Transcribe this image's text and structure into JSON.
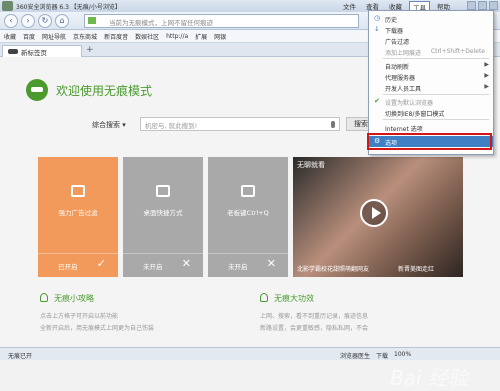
{
  "window": {
    "title": "360安全浏览器 6.3 【无痕/小号浏览】",
    "menus": [
      "文件",
      "查看",
      "收藏",
      "工具",
      "帮助"
    ],
    "active_menu": "工具"
  },
  "nav": {
    "address_placeholder": "当前为无痕模式，上网不留任何痕迹"
  },
  "bookmarks": [
    "收藏",
    "百度",
    "网址导航",
    "京东商城",
    "新百度音",
    "数娱社区",
    "http://a",
    "扩展",
    "网银"
  ],
  "tabs": [
    {
      "label": "新标签页"
    }
  ],
  "main": {
    "welcome": "欢迎使用无痕模式",
    "search_type": "综合搜索",
    "search_placeholder": "机密与, 就此搜到!",
    "search_button": "搜索"
  },
  "tiles": [
    {
      "label": "强力广告过滤",
      "state": "已开启",
      "mark": "✓",
      "color": "#f29a5b"
    },
    {
      "label": "桌面快捷方式",
      "state": "未开启",
      "mark": "✕",
      "color": "#a9a9a9"
    },
    {
      "label": "老板键Ctrl+Q",
      "state": "未开启",
      "mark": "✕",
      "color": "#a9a9a9"
    }
  ],
  "photo": {
    "title": "无聊就看",
    "caption_left": "北影学霸校花甜照萌翻网友",
    "caption_right": "新晋美图走红"
  },
  "tips": [
    {
      "heading": "无痕小攻略",
      "lines": [
        "点击上方格子可开启以前功能",
        "全新开启后，用无痕模式上网更为自己伤装"
      ]
    },
    {
      "heading": "无痕大功效",
      "lines": [
        "上网、搜索，看不到重历记录，痕迹信息",
        "新路设置，会更重敏感，隐私私网，不会"
      ]
    }
  ],
  "menu": {
    "items": [
      {
        "label": "历史",
        "shortcut": "",
        "gray": false,
        "arrow": false,
        "check": false
      },
      {
        "label": "下载器",
        "shortcut": "",
        "gray": false,
        "arrow": false,
        "check": false
      },
      {
        "label": "广告过滤",
        "shortcut": "",
        "gray": false,
        "arrow": false,
        "check": false
      },
      {
        "label": "添加上网痕迹",
        "shortcut": "Ctrl+Shift+Delete",
        "gray": true,
        "arrow": false,
        "check": false
      },
      {
        "label": "自动刷新",
        "shortcut": "",
        "gray": false,
        "arrow": true,
        "check": false
      },
      {
        "label": "代理服务器",
        "shortcut": "",
        "gray": false,
        "arrow": true,
        "check": false
      },
      {
        "label": "开发人员工具",
        "shortcut": "",
        "gray": false,
        "arrow": true,
        "check": false
      },
      {
        "label": "设置为默认浏览器",
        "shortcut": "",
        "gray": true,
        "arrow": false,
        "check": true
      },
      {
        "label": "切换到IE8/多窗口模式",
        "shortcut": "",
        "gray": false,
        "arrow": false,
        "check": false
      },
      {
        "label": "Internet 选项",
        "shortcut": "",
        "gray": false,
        "arrow": false,
        "check": false
      },
      {
        "label": "选项",
        "shortcut": "",
        "gray": false,
        "arrow": false,
        "check": false,
        "selected": true
      }
    ]
  },
  "status": {
    "left": "无痕已开",
    "items": [
      "浏览器医生",
      "下载",
      "100%"
    ]
  },
  "watermark": "Bai 经验"
}
